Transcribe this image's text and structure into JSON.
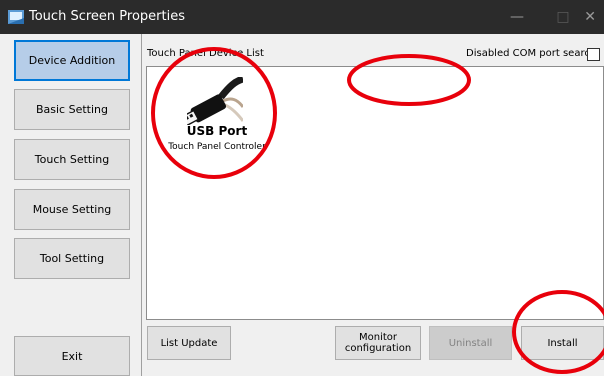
{
  "window": {
    "title": "Touch Screen Properties",
    "controls": {
      "minimize": "—",
      "maximize": "□",
      "close": "✕"
    }
  },
  "sidebar": {
    "items": [
      {
        "label": "Device Addition",
        "active": true
      },
      {
        "label": "Basic Setting",
        "active": false
      },
      {
        "label": "Touch Setting",
        "active": false
      },
      {
        "label": "Mouse Setting",
        "active": false
      },
      {
        "label": "Tool Setting",
        "active": false
      }
    ],
    "exit_label": "Exit"
  },
  "main": {
    "list_label": "Touch Panel Device List",
    "com_search_label": "Disabled COM port search",
    "com_search_checked": false,
    "devices": [
      {
        "icon": "usb-plug-icon",
        "type": "USB Port",
        "name": "Touch Panel Controler"
      }
    ]
  },
  "actions": {
    "list_update": "List Update",
    "monitor_configuration": "Monitor configuration",
    "uninstall": "Uninstall",
    "install": "Install"
  },
  "colors": {
    "titlebar": "#2b2b2b",
    "active_tab": "#b6cde8",
    "active_border": "#0078d7",
    "annotation": "#e8000b"
  }
}
